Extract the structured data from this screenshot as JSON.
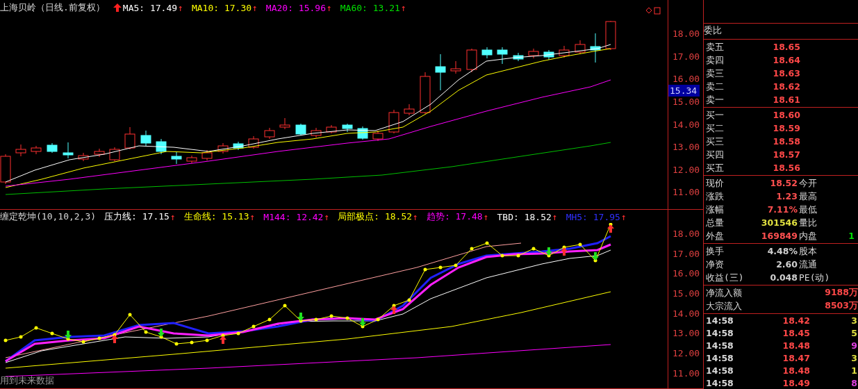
{
  "chart": {
    "title": "上海贝岭（日线.前复权）",
    "moving_averages": [
      {
        "label": "MA5: 17.49",
        "arrow": "↑",
        "color": "#ffffff"
      },
      {
        "label": "MA10: 17.30",
        "arrow": "↑",
        "color": "#ffff00"
      },
      {
        "label": "MA20: 15.96",
        "arrow": "↑",
        "color": "#ff00ff"
      },
      {
        "label": "MA60: 13.21",
        "arrow": "↑",
        "color": "#00e000"
      }
    ],
    "price_axis": [
      "18.00",
      "17.00",
      "16.00",
      "15.00",
      "14.00",
      "13.00",
      "12.00",
      "11.00"
    ],
    "price_tag": "15.34"
  },
  "indicator": {
    "title": "缠定乾坤(10,10,2,3)",
    "lines": [
      {
        "label": "压力线: 17.15",
        "arrow": "↑",
        "color": "#ffffff"
      },
      {
        "label": "生命线: 15.13",
        "arrow": "↑",
        "color": "#ffff00"
      },
      {
        "label": "M144: 12.42",
        "arrow": "↑",
        "color": "#ff00ff"
      },
      {
        "label": "局部极点: 18.52",
        "arrow": "↑",
        "color": "#ffff00"
      },
      {
        "label": "趋势: 17.48",
        "arrow": "↑",
        "color": "#ff00ff"
      },
      {
        "label": "TBD: 18.52",
        "arrow": "↑",
        "color": "#ffffff"
      },
      {
        "label": "MH5: 17.95",
        "arrow": "↑",
        "color": "#3030ff"
      }
    ],
    "axis": [
      "18.00",
      "17.00",
      "16.00",
      "15.00",
      "14.00",
      "13.00",
      "12.00",
      "11.00"
    ],
    "note": "用到未来数据"
  },
  "quote": {
    "ratio_label": "委比",
    "asks": [
      {
        "label": "卖五",
        "price": "18.65"
      },
      {
        "label": "卖四",
        "price": "18.64"
      },
      {
        "label": "卖三",
        "price": "18.63"
      },
      {
        "label": "卖二",
        "price": "18.62"
      },
      {
        "label": "卖一",
        "price": "18.61"
      }
    ],
    "bids": [
      {
        "label": "买一",
        "price": "18.60"
      },
      {
        "label": "买二",
        "price": "18.59"
      },
      {
        "label": "买三",
        "price": "18.58"
      },
      {
        "label": "买四",
        "price": "18.57"
      },
      {
        "label": "买五",
        "price": "18.56"
      }
    ],
    "stats": [
      {
        "label": "现价",
        "value": "18.52",
        "color": "#ff5050",
        "label_2": "今开"
      },
      {
        "label": "涨跌",
        "value": "1.23",
        "color": "#ff5050",
        "label_2": "最高"
      },
      {
        "label": "涨幅",
        "value": "7.11%",
        "color": "#ff5050",
        "label_2": "最低"
      },
      {
        "label": "总量",
        "value": "301546",
        "color": "#e0e040",
        "label_2": "量比"
      },
      {
        "label": "外盘",
        "value": "169849",
        "color": "#ff5050",
        "label_2": "内盘",
        "value_2": {
          "value": "1",
          "color": "#00e000"
        }
      }
    ],
    "finance": [
      {
        "label": "换手",
        "value": "4.48%",
        "label_2": "股本"
      },
      {
        "label": "净资",
        "value": "2.60",
        "label_2": "流通"
      },
      {
        "label": "收益(三)",
        "value": "0.048",
        "label_2": "PE(动)"
      }
    ],
    "fund_flow": [
      {
        "label": "净流入额",
        "value": "9188万"
      },
      {
        "label": "大宗流入",
        "value": "8503万"
      }
    ],
    "ticks": [
      {
        "time": "14:58",
        "price": "18.42",
        "volume": "3",
        "color": "#e0e040"
      },
      {
        "time": "14:58",
        "price": "18.45",
        "volume": "5",
        "color": "#e0e040"
      },
      {
        "time": "14:58",
        "price": "18.48",
        "volume": "9",
        "color": "#e040e0"
      },
      {
        "time": "14:58",
        "price": "18.47",
        "volume": "3",
        "color": "#e0e040"
      },
      {
        "time": "14:58",
        "price": "18.48",
        "volume": "1",
        "color": "#e0e040"
      },
      {
        "time": "14:58",
        "price": "18.49",
        "volume": "8",
        "color": "#e040e0"
      }
    ]
  }
}
